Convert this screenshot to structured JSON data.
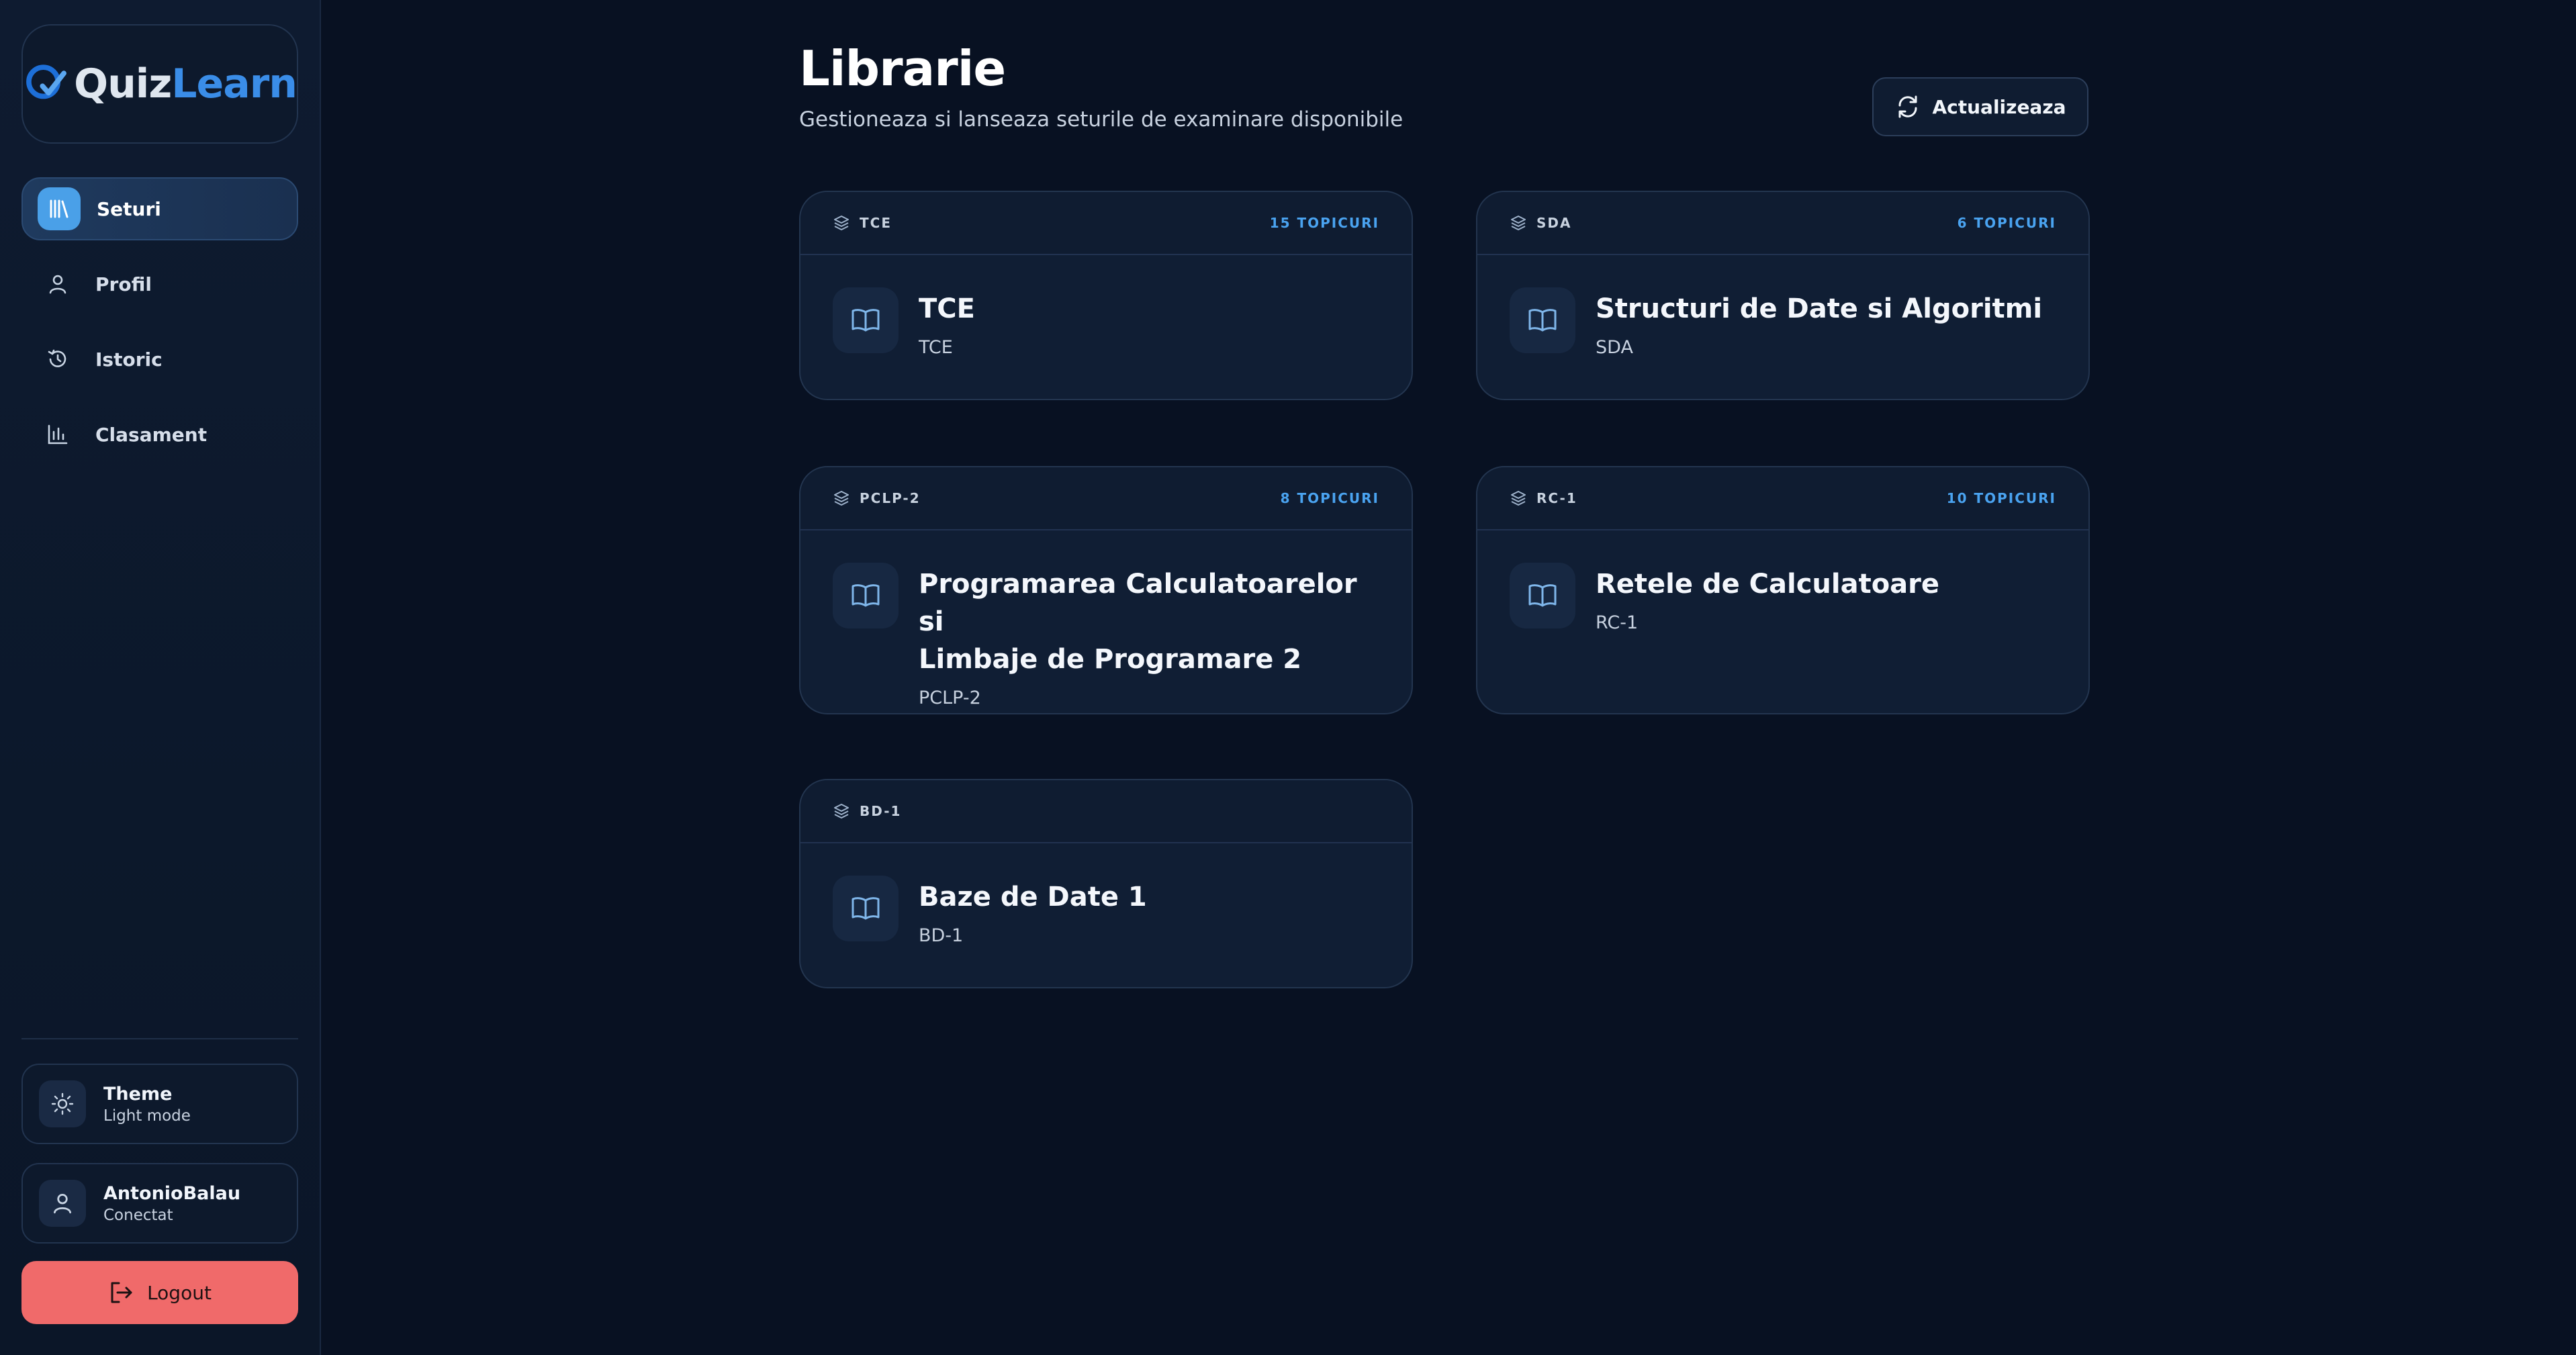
{
  "app": {
    "logo_part1": "Quiz",
    "logo_part2": "Learn"
  },
  "sidebar": {
    "items": [
      {
        "label": "Seturi",
        "icon": "library-icon",
        "active": true
      },
      {
        "label": "Profil",
        "icon": "user-icon",
        "active": false
      },
      {
        "label": "Istoric",
        "icon": "history-icon",
        "active": false
      },
      {
        "label": "Clasament",
        "icon": "bar-chart-icon",
        "active": false
      }
    ],
    "theme": {
      "title": "Theme",
      "subtitle": "Light mode",
      "icon": "sun-icon"
    },
    "user": {
      "name": "AntonioBalau",
      "status": "Conectat",
      "icon": "user-icon"
    },
    "logout_label": "Logout"
  },
  "main": {
    "title": "Librarie",
    "subtitle": "Gestioneaza si lanseaza seturile de examinare disponibile",
    "refresh_label": "Actualizeaza",
    "cards": [
      {
        "code": "TCE",
        "count": "15 TOPICURI",
        "title": "TCE",
        "subtitle": "TCE"
      },
      {
        "code": "SDA",
        "count": "6 TOPICURI",
        "title": "Structuri de Date si Algoritmi",
        "subtitle": "SDA"
      },
      {
        "code": "PCLP-2",
        "count": "8 TOPICURI",
        "title_line1": "Programarea Calculatoarelor si",
        "title_line2": "Limbaje de Programare 2",
        "subtitle": "PCLP-2"
      },
      {
        "code": "RC-1",
        "count": "10 TOPICURI",
        "title": "Retele de Calculatoare",
        "subtitle": "RC-1"
      },
      {
        "code": "BD-1",
        "count": "",
        "title": "Baze de Date 1",
        "subtitle": "BD-1"
      }
    ]
  },
  "colors": {
    "background": "#081122",
    "accent": "#4aa3f0",
    "logout": "#f06a6a"
  }
}
